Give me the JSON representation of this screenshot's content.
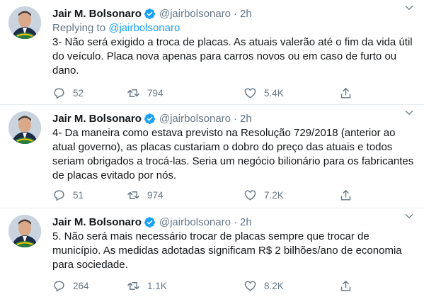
{
  "tweets": [
    {
      "name": "Jair M. Bolsonaro",
      "handle": "@jairbolsonaro",
      "separator": "·",
      "time": "2h",
      "replying_prefix": "Replying to ",
      "replying_handle": "@jairbolsonaro",
      "text": "3- Não será exigido a troca de placas. As atuais valerão até o fim da vida útil\ndo veículo. Placa nova apenas para carros novos ou em caso de furto ou\ndano.",
      "replies": "52",
      "retweets": "794",
      "likes": "5.4K"
    },
    {
      "name": "Jair M. Bolsonaro",
      "handle": "@jairbolsonaro",
      "separator": "·",
      "time": "2h",
      "text": "4- Da maneira como estava previsto na Resolução 729/2018 (anterior ao\natual governo), as placas custariam o dobro do preço das atuais e todos\nseriam obrigados a trocá-las. Seria um negócio bilionário para os fabricantes\nde placas evitado por nós.",
      "replies": "51",
      "retweets": "974",
      "likes": "7.2K"
    },
    {
      "name": "Jair M. Bolsonaro",
      "handle": "@jairbolsonaro",
      "separator": "·",
      "time": "2h",
      "text": "5. Não será mais necessário trocar de placas sempre que trocar de\nmunicípio. As medidas adotadas significam R$ 2 bilhões/ano de economia\npara sociedade.",
      "replies": "264",
      "retweets": "1.1K",
      "likes": "8.2K"
    }
  ],
  "icons": {
    "verified": "verified-badge-icon",
    "caret": "chevron-down-icon",
    "reply": "reply-icon",
    "retweet": "retweet-icon",
    "like": "heart-icon",
    "share": "share-icon"
  },
  "colors": {
    "accent": "#1da1f2",
    "secondary_text": "#657786",
    "primary_text": "#14171a",
    "border": "#e6ecf0"
  }
}
